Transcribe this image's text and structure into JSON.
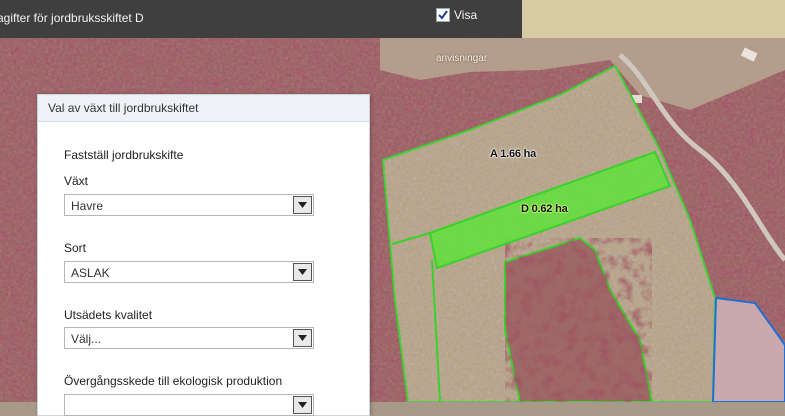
{
  "topbar": {
    "title": "agifter för jordbruksskiftet D",
    "visa_label": "Visa",
    "visa_checked": true
  },
  "map": {
    "hint": "anvisningar",
    "area_a_label": "A 1.66 ha",
    "area_d_label": "D 0.62 ha",
    "colors": {
      "field_outline": "#3bd12c",
      "selected_field_fill": "#5fe23a",
      "parcel_outline": "#1f6fd6",
      "forest": "#9c4a52",
      "field_soil": "#b8a388"
    }
  },
  "panel": {
    "header": "Val av växt till jordbrukskiftet",
    "subtitle": "Fastställ jordbrukskifte",
    "fields": [
      {
        "label": "Växt",
        "value": "Havre"
      },
      {
        "label": "Sort",
        "value": "ASLAK"
      },
      {
        "label": "Utsädets kvalitet",
        "value": "Välj..."
      },
      {
        "label": "Övergångsskede till ekologisk produktion",
        "value": ""
      }
    ]
  }
}
